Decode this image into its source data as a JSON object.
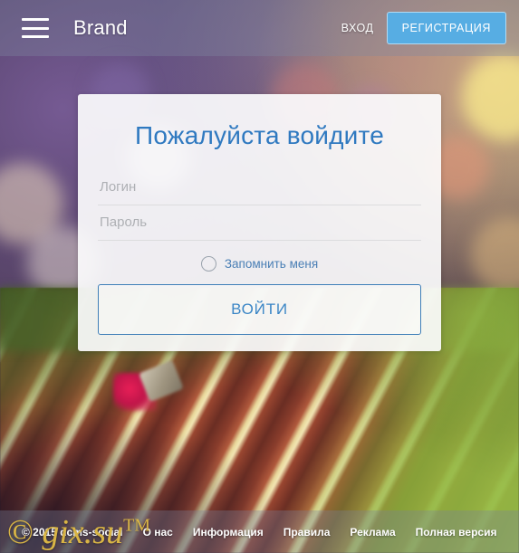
{
  "header": {
    "menu_icon": "hamburger-menu-icon",
    "brand": "Brand",
    "login_link": "ВХОД",
    "register_button": "РЕГИСТРАЦИЯ",
    "accent_color": "#57ADE3"
  },
  "login_card": {
    "title": "Пожалуйста войдите",
    "username": {
      "value": "",
      "placeholder": "Логин"
    },
    "password": {
      "value": "",
      "placeholder": "Пароль"
    },
    "remember": {
      "label": "Запомнить меня",
      "checked": false
    },
    "submit_button": "ВОЙТИ",
    "title_color": "#2f79c0",
    "button_border_color": "#3f7fb8"
  },
  "footer": {
    "copyright": "© 2015 dcms-social",
    "links": [
      {
        "label": "О нас"
      },
      {
        "label": "Информация"
      },
      {
        "label": "Правила"
      },
      {
        "label": "Реклама"
      },
      {
        "label": "Полная версия"
      }
    ]
  },
  "watermark": {
    "copyright_symbol": "©",
    "text": "gix.su",
    "trademark": "TM",
    "color": "#d9b545"
  }
}
